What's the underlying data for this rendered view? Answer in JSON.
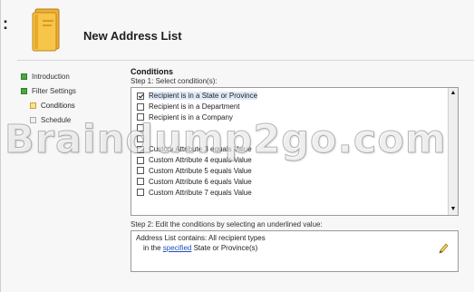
{
  "header": {
    "colon": ":",
    "title": "New Address List",
    "icon": "folder-book-icon"
  },
  "nav": {
    "items": [
      {
        "label": "Introduction",
        "icon": "green-box"
      },
      {
        "label": "Filter Settings",
        "icon": "green-box"
      },
      {
        "label": "Conditions",
        "icon": "orange-box"
      },
      {
        "label": "Schedule",
        "icon": "gray-box"
      }
    ]
  },
  "conditions": {
    "title": "Conditions",
    "step1_label": "Step 1: Select condition(s):",
    "items": [
      {
        "label": "Recipient is in a State or Province",
        "checked": true
      },
      {
        "label": "Recipient is in a Department",
        "checked": false
      },
      {
        "label": "Recipient is in a Company",
        "checked": false
      },
      {
        "label": "",
        "checked": false
      },
      {
        "label": "",
        "checked": false
      },
      {
        "label": "Custom Attribute 3 equals Value",
        "checked": false
      },
      {
        "label": "Custom Attribute 4 equals Value",
        "checked": false
      },
      {
        "label": "Custom Attribute 5 equals Value",
        "checked": false
      },
      {
        "label": "Custom Attribute 6 equals Value",
        "checked": false
      },
      {
        "label": "Custom Attribute 7 equals Value",
        "checked": false
      }
    ],
    "scroll_up": "▲",
    "scroll_down": "▼",
    "step2_label": "Step 2: Edit the conditions by selecting an underlined value:",
    "edit_line1": "Address List contains: All recipient types",
    "edit_line2_prefix": "in the ",
    "edit_link": "specified",
    "edit_line2_suffix": " State or Province(s)"
  },
  "watermark": "Braindump2go.com",
  "colors": {
    "accent_green": "#4aa844",
    "accent_orange": "#d5a21c",
    "link_blue": "#1f4fb7"
  }
}
